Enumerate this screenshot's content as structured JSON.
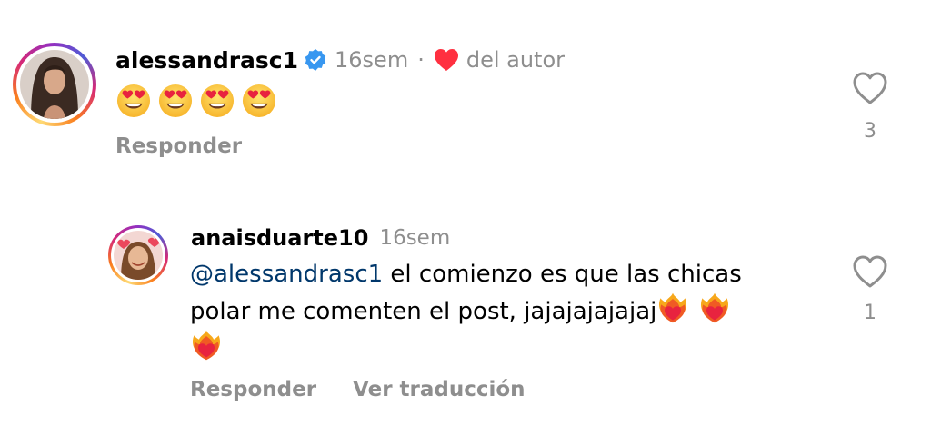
{
  "comments": [
    {
      "username": "alessandrasc1",
      "verified": true,
      "time": "16sem",
      "separator": "·",
      "author_like_label": "del autor",
      "body_emojis": [
        "heart-eyes-emoji",
        "heart-eyes-emoji",
        "heart-eyes-emoji",
        "heart-eyes-emoji"
      ],
      "reply_label": "Responder",
      "like_count": "3"
    },
    {
      "username": "anaisduarte10",
      "time": "16sem",
      "mention": "@alessandrasc1",
      "text_line1": " el comienzo es que las chicas",
      "text_line2": "polar me comenten el post, jajajajajajaj",
      "trailing_emojis": [
        "heart-on-fire-emoji",
        "heart-on-fire-emoji",
        "heart-on-fire-emoji"
      ],
      "reply_label": "Responder",
      "translate_label": "Ver traducción",
      "like_count": "1"
    }
  ],
  "colors": {
    "verified_blue": "#3897f0",
    "like_red": "#ff3040",
    "muted_gray": "#8e8e8e",
    "mention_blue": "#00376b"
  }
}
